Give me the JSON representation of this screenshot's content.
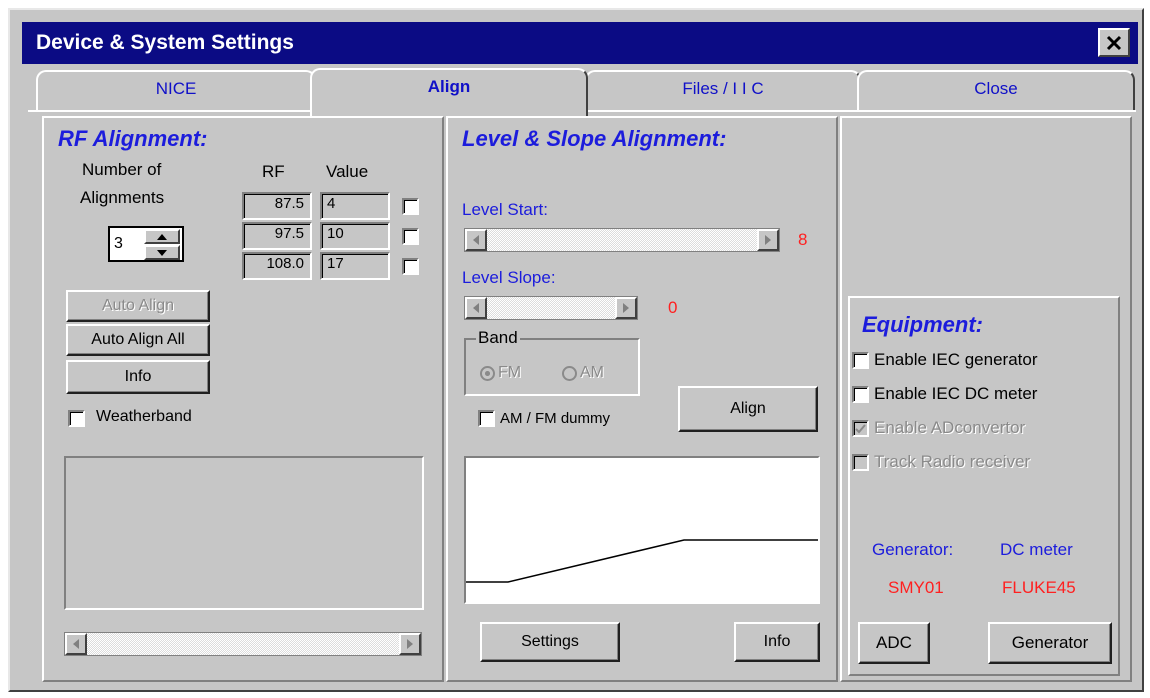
{
  "window": {
    "title": "Device & System Settings"
  },
  "tabs": [
    {
      "label": "NICE"
    },
    {
      "label": "Align"
    },
    {
      "label": "Files / I I C"
    },
    {
      "label": "Close"
    }
  ],
  "rf": {
    "heading": "RF Alignment:",
    "num_label_1": "Number of",
    "num_label_2": "Alignments",
    "spinner_value": "3",
    "col_rf": "RF",
    "col_value": "Value",
    "rows": [
      {
        "rf": "87.5",
        "value": "4"
      },
      {
        "rf": "97.5",
        "value": "10"
      },
      {
        "rf": "108.0",
        "value": "17"
      }
    ],
    "btn_auto_align": "Auto Align",
    "btn_auto_align_all": "Auto Align All",
    "btn_info": "Info",
    "weatherband": "Weatherband"
  },
  "level": {
    "heading": "Level & Slope Alignment:",
    "start_label": "Level Start:",
    "start_value": "8",
    "slope_label": "Level Slope:",
    "slope_value": "0",
    "band_label": "Band",
    "band_fm": "FM",
    "band_am": "AM",
    "dummy_label": "AM / FM dummy",
    "btn_align": "Align",
    "btn_settings": "Settings",
    "btn_info": "Info"
  },
  "equipment": {
    "heading": "Equipment:",
    "options": [
      {
        "label": "Enable IEC generator",
        "checked": false,
        "enabled": true
      },
      {
        "label": "Enable IEC DC meter",
        "checked": false,
        "enabled": true
      },
      {
        "label": "Enable ADconvertor",
        "checked": true,
        "enabled": false
      },
      {
        "label": "Track Radio receiver",
        "checked": false,
        "enabled": false
      }
    ],
    "generator_label": "Generator:",
    "dcmeter_label": "DC meter",
    "generator_value": "SMY01",
    "dcmeter_value": "FLUKE45",
    "btn_adc": "ADC",
    "btn_generator": "Generator"
  },
  "colors": {
    "accent": "#1c1cdc",
    "value_red": "#ff2020",
    "titlebar": "#0b0b84"
  }
}
